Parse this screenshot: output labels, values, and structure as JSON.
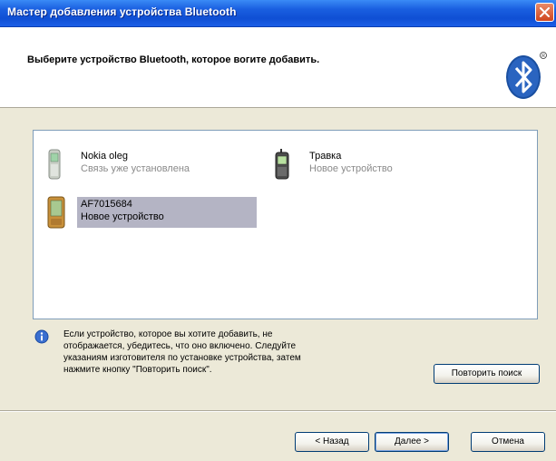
{
  "window": {
    "title": "Мастер добавления устройства Bluetooth"
  },
  "header": {
    "heading": "Выберите устройство Bluetooth, которое вогите добавить."
  },
  "devices": [
    {
      "name": "Nokia oleg",
      "status": "Связь уже установлена",
      "icon": "phone-icon",
      "selected": false
    },
    {
      "name": "Травка",
      "status": "Новое устройство",
      "icon": "phone-icon",
      "selected": false
    },
    {
      "name": "AF7015684",
      "status": "Новое устройство",
      "icon": "pda-icon",
      "selected": true
    }
  ],
  "info": {
    "icon": "info-icon",
    "text": "Если устройство, которое вы хотите добавить, не\nотображается, убедитесь, что оно включено. Следуйте\nуказаниям изготовителя по установке устройства, затем\nнажмите кнопку \"Повторить поиск\"."
  },
  "buttons": {
    "rescan": "Повторить поиск",
    "back": "< Назад",
    "next": "Далее >",
    "cancel": "Отмена"
  },
  "colors": {
    "title_bar": "#1a5fe0",
    "selection": "#b4b4c4",
    "bluetooth": "#1a4fa0"
  }
}
